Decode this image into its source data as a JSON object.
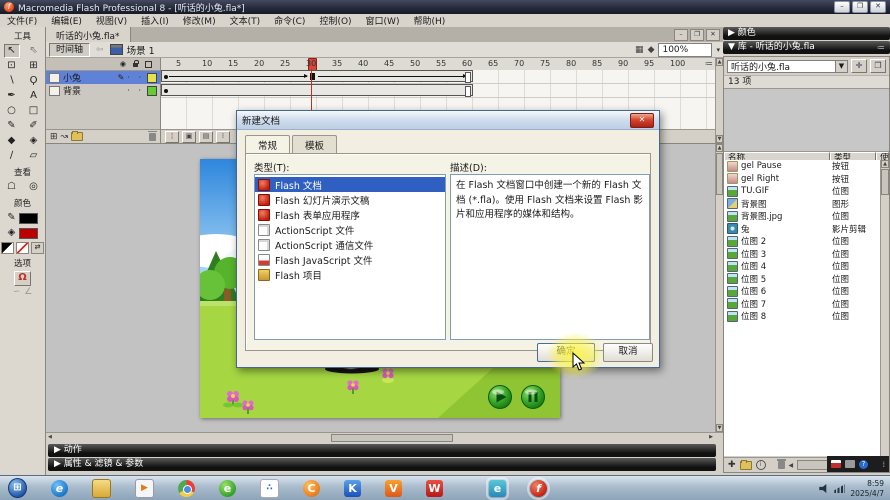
{
  "colors": {
    "selection_accent": "#2f5fc0",
    "layer_selected": "#5f82d8",
    "stage_sky": "#2e86dd",
    "stage_grass": "#a6d743",
    "highlight": "#faf346",
    "playhead_red": "#d8453a"
  },
  "window": {
    "title": "Macromedia Flash Professional 8 - [听话的小兔.fla*]",
    "minimize": "–",
    "restore": "❐",
    "close": "✕"
  },
  "menu": {
    "items": [
      "文件(F)",
      "编辑(E)",
      "视图(V)",
      "插入(I)",
      "修改(M)",
      "文本(T)",
      "命令(C)",
      "控制(O)",
      "窗口(W)",
      "帮助(H)"
    ]
  },
  "tools": {
    "tools_label": "工具",
    "view_label": "查看",
    "colors_label": "颜色",
    "options_label": "选项",
    "items": [
      {
        "name": "selection-tool",
        "glyph": "↖",
        "cls": "pressed"
      },
      {
        "name": "subselection-tool",
        "glyph": "⇖",
        "cls": "dim"
      },
      {
        "name": "free-transform-tool",
        "glyph": "⊡",
        "cls": ""
      },
      {
        "name": "gradient-transform-tool",
        "glyph": "⊞",
        "cls": ""
      },
      {
        "name": "line-tool",
        "glyph": "∖",
        "cls": ""
      },
      {
        "name": "lasso-tool",
        "glyph": "Ϙ",
        "cls": ""
      },
      {
        "name": "pen-tool",
        "glyph": "✒",
        "cls": ""
      },
      {
        "name": "text-tool",
        "glyph": "A",
        "cls": ""
      },
      {
        "name": "oval-tool",
        "glyph": "○",
        "cls": ""
      },
      {
        "name": "rectangle-tool",
        "glyph": "□",
        "cls": ""
      },
      {
        "name": "pencil-tool",
        "glyph": "✎",
        "cls": ""
      },
      {
        "name": "brush-tool",
        "glyph": "✐",
        "cls": ""
      },
      {
        "name": "ink-bottle-tool",
        "glyph": "◆",
        "cls": ""
      },
      {
        "name": "paint-bucket-tool",
        "glyph": "◈",
        "cls": ""
      },
      {
        "name": "eyedropper-tool",
        "glyph": "∕",
        "cls": ""
      },
      {
        "name": "eraser-tool",
        "glyph": "▱",
        "cls": ""
      }
    ],
    "view_items": [
      {
        "name": "hand-tool",
        "glyph": "☖",
        "cls": ""
      },
      {
        "name": "zoom-tool",
        "glyph": "◎",
        "cls": ""
      }
    ],
    "stroke_color": "#000000",
    "fill_color": "#bb0000",
    "option_glyphs": {
      "magnet": "Ω",
      "smooth": "∽",
      "straighten": "∠"
    }
  },
  "document": {
    "tab": "听话的小兔.fla*",
    "timeline_button": "时间轴",
    "scene": "场景 1",
    "zoom": "100%"
  },
  "timeline": {
    "ruler": [
      1,
      5,
      10,
      15,
      20,
      25,
      30,
      35,
      40,
      45,
      50,
      55,
      60,
      65,
      70,
      75,
      80,
      85,
      90,
      95,
      100
    ],
    "playhead_frame": "30",
    "layers": [
      {
        "name": "小兔",
        "cls": "selected",
        "color": "#e8e24a",
        "pencil": "✎",
        "dots": "· ·"
      },
      {
        "name": "背景",
        "cls": "",
        "color": "#66cc33",
        "pencil": "",
        "dots": "· ·"
      }
    ]
  },
  "dialog": {
    "title": "新建文档",
    "tabs": [
      {
        "label": "常规",
        "cls": "active"
      },
      {
        "label": "模板",
        "cls": ""
      }
    ],
    "type_label": "类型(T):",
    "desc_label": "描述(D):",
    "types": [
      {
        "label": "Flash 文档",
        "icon": "ic-red",
        "cls": "selected"
      },
      {
        "label": "Flash 幻灯片演示文稿",
        "icon": "ic-red",
        "cls": ""
      },
      {
        "label": "Flash 表单应用程序",
        "icon": "ic-red",
        "cls": ""
      },
      {
        "label": "ActionScript 文件",
        "icon": "ic-page",
        "cls": ""
      },
      {
        "label": "ActionScript 通信文件",
        "icon": "ic-page",
        "cls": ""
      },
      {
        "label": "Flash JavaScript 文件",
        "icon": "ic-pagejs",
        "cls": ""
      },
      {
        "label": "Flash 项目",
        "icon": "ic-folder",
        "cls": ""
      }
    ],
    "description": "在 Flash 文档窗口中创建一个新的 Flash 文档 (*.fla)。使用 Flash 文档来设置 Flash 影片和应用程序的媒体和结构。",
    "ok": "确定",
    "cancel": "取消",
    "close_glyph": "✕"
  },
  "right": {
    "color_panel": "颜色",
    "library_panel": "库 - 听话的小兔.fla",
    "library_select": "听话的小兔.fla",
    "count": "13 项",
    "columns": {
      "name": "名称",
      "type": "类型",
      "use": "使"
    },
    "items": [
      {
        "name": "gel Pause",
        "type": "按钮",
        "icon": "li-btn"
      },
      {
        "name": "gel Right",
        "type": "按钮",
        "icon": "li-btn"
      },
      {
        "name": "TU.GIF",
        "type": "位图",
        "icon": "li-bmp"
      },
      {
        "name": "背景图",
        "type": "图形",
        "icon": "li-gfx"
      },
      {
        "name": "背景图.jpg",
        "type": "位图",
        "icon": "li-bmp"
      },
      {
        "name": "兔",
        "type": "影片剪辑",
        "icon": "li-mc"
      },
      {
        "name": "位图 2",
        "type": "位图",
        "icon": "li-bmp"
      },
      {
        "name": "位图 3",
        "type": "位图",
        "icon": "li-bmp"
      },
      {
        "name": "位图 4",
        "type": "位图",
        "icon": "li-bmp"
      },
      {
        "name": "位图 5",
        "type": "位图",
        "icon": "li-bmp"
      },
      {
        "name": "位图 6",
        "type": "位图",
        "icon": "li-bmp"
      },
      {
        "name": "位图 7",
        "type": "位图",
        "icon": "li-bmp"
      },
      {
        "name": "位图 8",
        "type": "位图",
        "icon": "li-bmp"
      }
    ]
  },
  "bottom": {
    "actions": "动作",
    "properties": "属性 & 滤镜 & 参数"
  },
  "taskbar": {
    "clock": "8:59",
    "date": "2025/4/7",
    "icons": [
      {
        "name": "start-button",
        "cls": "tb-start",
        "glyph": "⊞"
      },
      {
        "name": "ie-icon",
        "cls": "tb-ie",
        "glyph": "e"
      },
      {
        "name": "file-explorer-icon",
        "cls": "tb-folder",
        "glyph": ""
      },
      {
        "name": "media-player-icon",
        "cls": "tb-player",
        "glyph": "▶"
      },
      {
        "name": "chrome-icon",
        "cls": "tb-chrome",
        "glyph": ""
      },
      {
        "name": "360-browser-icon",
        "cls": "tb-360",
        "glyph": "e"
      },
      {
        "name": "app-circles-icon",
        "cls": "tb-circles",
        "glyph": "∴"
      },
      {
        "name": "liebao-browser-icon",
        "cls": "tb-liebao",
        "glyph": "C"
      },
      {
        "name": "kingsoft-icon",
        "cls": "tb-k",
        "glyph": "K"
      },
      {
        "name": "v-office-icon",
        "cls": "tb-v",
        "glyph": "V"
      },
      {
        "name": "wps-icon",
        "cls": "tb-wps",
        "glyph": "W"
      },
      {
        "name": "teal-browser-icon",
        "cls": "tb-teal open gap",
        "glyph": "e"
      },
      {
        "name": "flash-app-icon",
        "cls": "tb-flash open",
        "glyph": "f"
      }
    ]
  }
}
